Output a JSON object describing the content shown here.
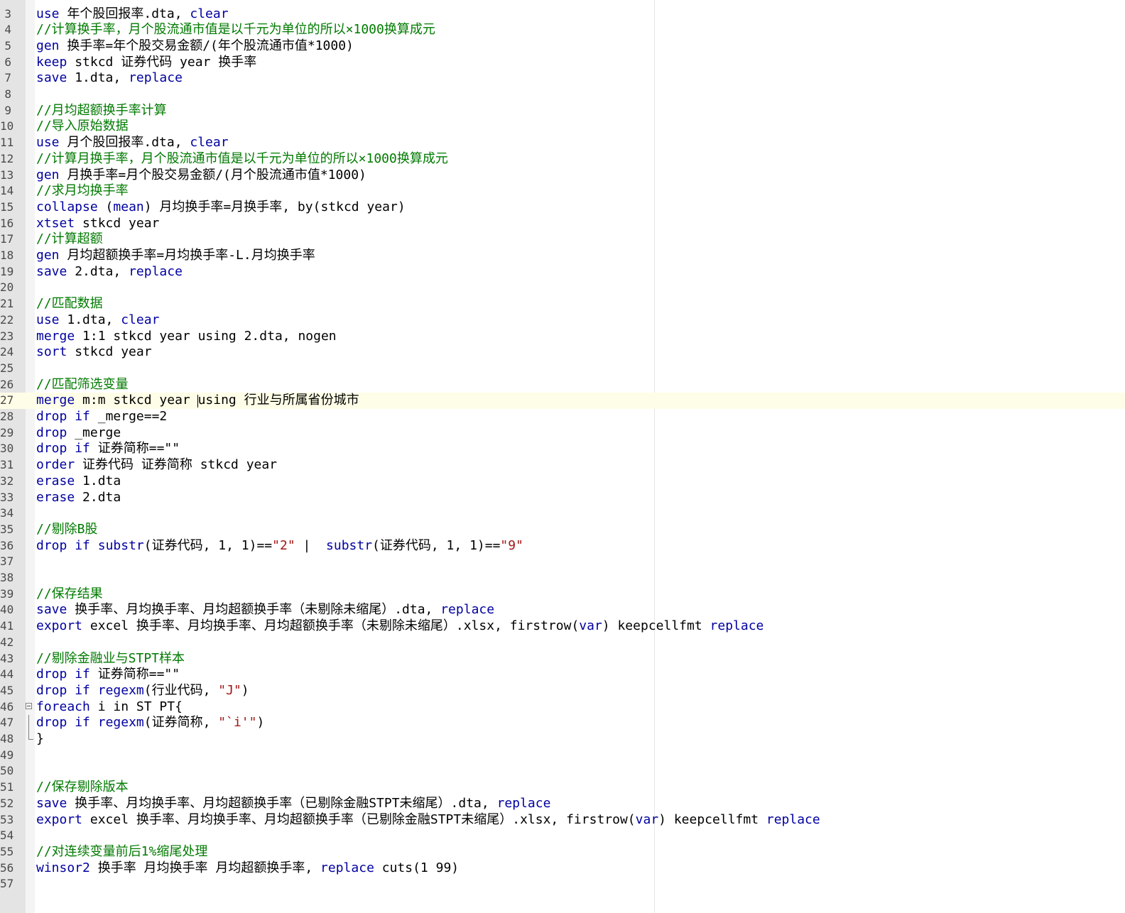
{
  "editor": {
    "lines": [
      {
        "n": "3",
        "segs": [
          [
            "kw",
            "use"
          ],
          [
            "t",
            " 年个股回报率.dta, "
          ],
          [
            "kw",
            "clear"
          ]
        ]
      },
      {
        "n": "4",
        "segs": [
          [
            "cm",
            "//计算换手率，月个股流通市值是以千元为单位的所以×1000换算成元"
          ]
        ]
      },
      {
        "n": "5",
        "segs": [
          [
            "kw",
            "gen"
          ],
          [
            "t",
            " 换手率=年个股交易金额/(年个股流通市值*1000)"
          ]
        ]
      },
      {
        "n": "6",
        "segs": [
          [
            "kw",
            "keep"
          ],
          [
            "t",
            " stkcd 证券代码 year 换手率"
          ]
        ]
      },
      {
        "n": "7",
        "segs": [
          [
            "kw",
            "save"
          ],
          [
            "t",
            " 1.dta, "
          ],
          [
            "kw",
            "replace"
          ]
        ]
      },
      {
        "n": "8",
        "segs": []
      },
      {
        "n": "9",
        "segs": [
          [
            "cm",
            "//月均超额换手率计算"
          ]
        ]
      },
      {
        "n": "10",
        "segs": [
          [
            "cm",
            "//导入原始数据"
          ]
        ]
      },
      {
        "n": "11",
        "segs": [
          [
            "kw",
            "use"
          ],
          [
            "t",
            " 月个股回报率.dta, "
          ],
          [
            "kw",
            "clear"
          ]
        ]
      },
      {
        "n": "12",
        "segs": [
          [
            "cm",
            "//计算月换手率，月个股流通市值是以千元为单位的所以×1000换算成元"
          ]
        ]
      },
      {
        "n": "13",
        "segs": [
          [
            "kw",
            "gen"
          ],
          [
            "t",
            " 月换手率=月个股交易金额/(月个股流通市值*1000)"
          ]
        ]
      },
      {
        "n": "14",
        "segs": [
          [
            "cm",
            "//求月均换手率"
          ]
        ]
      },
      {
        "n": "15",
        "segs": [
          [
            "kw",
            "collapse"
          ],
          [
            "t",
            " ("
          ],
          [
            "kw",
            "mean"
          ],
          [
            "t",
            ") 月均换手率=月换手率, by(stkcd year)"
          ]
        ]
      },
      {
        "n": "16",
        "segs": [
          [
            "kw",
            "xtset"
          ],
          [
            "t",
            " stkcd year"
          ]
        ]
      },
      {
        "n": "17",
        "segs": [
          [
            "cm",
            "//计算超额"
          ]
        ]
      },
      {
        "n": "18",
        "segs": [
          [
            "kw",
            "gen"
          ],
          [
            "t",
            " 月均超额换手率=月均换手率-L.月均换手率"
          ]
        ]
      },
      {
        "n": "19",
        "segs": [
          [
            "kw",
            "save"
          ],
          [
            "t",
            " 2.dta, "
          ],
          [
            "kw",
            "replace"
          ]
        ]
      },
      {
        "n": "20",
        "segs": []
      },
      {
        "n": "21",
        "segs": [
          [
            "cm",
            "//匹配数据"
          ]
        ]
      },
      {
        "n": "22",
        "segs": [
          [
            "kw",
            "use"
          ],
          [
            "t",
            " 1.dta, "
          ],
          [
            "kw",
            "clear"
          ]
        ]
      },
      {
        "n": "23",
        "segs": [
          [
            "kw",
            "merge"
          ],
          [
            "t",
            " 1:1 stkcd year using 2.dta, nogen"
          ]
        ]
      },
      {
        "n": "24",
        "segs": [
          [
            "kw",
            "sort"
          ],
          [
            "t",
            " stkcd year"
          ]
        ]
      },
      {
        "n": "25",
        "segs": []
      },
      {
        "n": "26",
        "segs": [
          [
            "cm",
            "//匹配筛选变量"
          ]
        ]
      },
      {
        "n": "27",
        "segs": [
          [
            "kw",
            "merge"
          ],
          [
            "t",
            " m:m stkcd year using 行业与所属省份城市"
          ]
        ]
      },
      {
        "n": "28",
        "segs": [
          [
            "kw",
            "drop"
          ],
          [
            "t",
            " "
          ],
          [
            "kw",
            "if"
          ],
          [
            "t",
            " _merge==2"
          ]
        ]
      },
      {
        "n": "29",
        "segs": [
          [
            "kw",
            "drop"
          ],
          [
            "t",
            " _merge"
          ]
        ]
      },
      {
        "n": "30",
        "segs": [
          [
            "kw",
            "drop"
          ],
          [
            "t",
            " "
          ],
          [
            "kw",
            "if"
          ],
          [
            "t",
            " 证券简称==\"\""
          ]
        ]
      },
      {
        "n": "31",
        "segs": [
          [
            "kw",
            "order"
          ],
          [
            "t",
            " 证券代码 证券简称 stkcd year"
          ]
        ]
      },
      {
        "n": "32",
        "segs": [
          [
            "kw",
            "erase"
          ],
          [
            "t",
            " 1.dta"
          ]
        ]
      },
      {
        "n": "33",
        "segs": [
          [
            "kw",
            "erase"
          ],
          [
            "t",
            " 2.dta"
          ]
        ]
      },
      {
        "n": "34",
        "segs": []
      },
      {
        "n": "35",
        "segs": [
          [
            "cm",
            "//剔除B股"
          ]
        ]
      },
      {
        "n": "36",
        "segs": [
          [
            "kw",
            "drop"
          ],
          [
            "t",
            " "
          ],
          [
            "kw",
            "if"
          ],
          [
            "t",
            " "
          ],
          [
            "kw",
            "substr"
          ],
          [
            "t",
            "(证券代码, 1, 1)=="
          ],
          [
            "str",
            "\"2\""
          ],
          [
            "t",
            " |  "
          ],
          [
            "kw",
            "substr"
          ],
          [
            "t",
            "(证券代码, 1, 1)=="
          ],
          [
            "str",
            "\"9\""
          ]
        ]
      },
      {
        "n": "37",
        "segs": []
      },
      {
        "n": "38",
        "segs": []
      },
      {
        "n": "39",
        "segs": [
          [
            "cm",
            "//保存结果"
          ]
        ]
      },
      {
        "n": "40",
        "segs": [
          [
            "kw",
            "save"
          ],
          [
            "t",
            " 换手率、月均换手率、月均超额换手率（未剔除未缩尾）.dta, "
          ],
          [
            "kw",
            "replace"
          ]
        ]
      },
      {
        "n": "41",
        "segs": [
          [
            "kw",
            "export"
          ],
          [
            "t",
            " excel 换手率、月均换手率、月均超额换手率（未剔除未缩尾）.xlsx, firstrow("
          ],
          [
            "kw",
            "var"
          ],
          [
            "t",
            ") keepcellfmt "
          ],
          [
            "kw",
            "replace"
          ]
        ]
      },
      {
        "n": "42",
        "segs": []
      },
      {
        "n": "43",
        "segs": [
          [
            "cm",
            "//剔除金融业与STPT样本"
          ]
        ]
      },
      {
        "n": "44",
        "segs": [
          [
            "kw",
            "drop"
          ],
          [
            "t",
            " "
          ],
          [
            "kw",
            "if"
          ],
          [
            "t",
            " 证券简称==\"\""
          ]
        ]
      },
      {
        "n": "45",
        "segs": [
          [
            "kw",
            "drop"
          ],
          [
            "t",
            " "
          ],
          [
            "kw",
            "if"
          ],
          [
            "t",
            " "
          ],
          [
            "kw",
            "regexm"
          ],
          [
            "t",
            "(行业代码, "
          ],
          [
            "str",
            "\"J\""
          ],
          [
            "t",
            ")"
          ]
        ]
      },
      {
        "n": "46",
        "segs": [
          [
            "kw",
            "foreach"
          ],
          [
            "t",
            " i in ST PT{"
          ]
        ]
      },
      {
        "n": "47",
        "segs": [
          [
            "kw",
            "drop"
          ],
          [
            "t",
            " "
          ],
          [
            "kw",
            "if"
          ],
          [
            "t",
            " "
          ],
          [
            "kw",
            "regexm"
          ],
          [
            "t",
            "(证券简称, "
          ],
          [
            "str",
            "\"`i'\""
          ],
          [
            "t",
            ")"
          ]
        ]
      },
      {
        "n": "48",
        "segs": [
          [
            "t",
            "}"
          ]
        ]
      },
      {
        "n": "49",
        "segs": []
      },
      {
        "n": "50",
        "segs": []
      },
      {
        "n": "51",
        "segs": [
          [
            "cm",
            "//保存剔除版本"
          ]
        ]
      },
      {
        "n": "52",
        "segs": [
          [
            "kw",
            "save"
          ],
          [
            "t",
            " 换手率、月均换手率、月均超额换手率（已剔除金融STPT未缩尾）.dta, "
          ],
          [
            "kw",
            "replace"
          ]
        ]
      },
      {
        "n": "53",
        "segs": [
          [
            "kw",
            "export"
          ],
          [
            "t",
            " excel 换手率、月均换手率、月均超额换手率（已剔除金融STPT未缩尾）.xlsx, firstrow("
          ],
          [
            "kw",
            "var"
          ],
          [
            "t",
            ") keepcellfmt "
          ],
          [
            "kw",
            "replace"
          ]
        ]
      },
      {
        "n": "54",
        "segs": []
      },
      {
        "n": "55",
        "segs": [
          [
            "cm",
            "//对连续变量前后1%缩尾处理"
          ]
        ]
      },
      {
        "n": "56",
        "segs": [
          [
            "kw",
            "winsor2"
          ],
          [
            "t",
            " 换手率 月均换手率 月均超额换手率, "
          ],
          [
            "kw",
            "replace"
          ],
          [
            "t",
            " cuts(1 99)"
          ]
        ]
      },
      {
        "n": "57",
        "segs": []
      }
    ],
    "current_line": "27",
    "fold_start": "46",
    "fold_end": "48"
  }
}
